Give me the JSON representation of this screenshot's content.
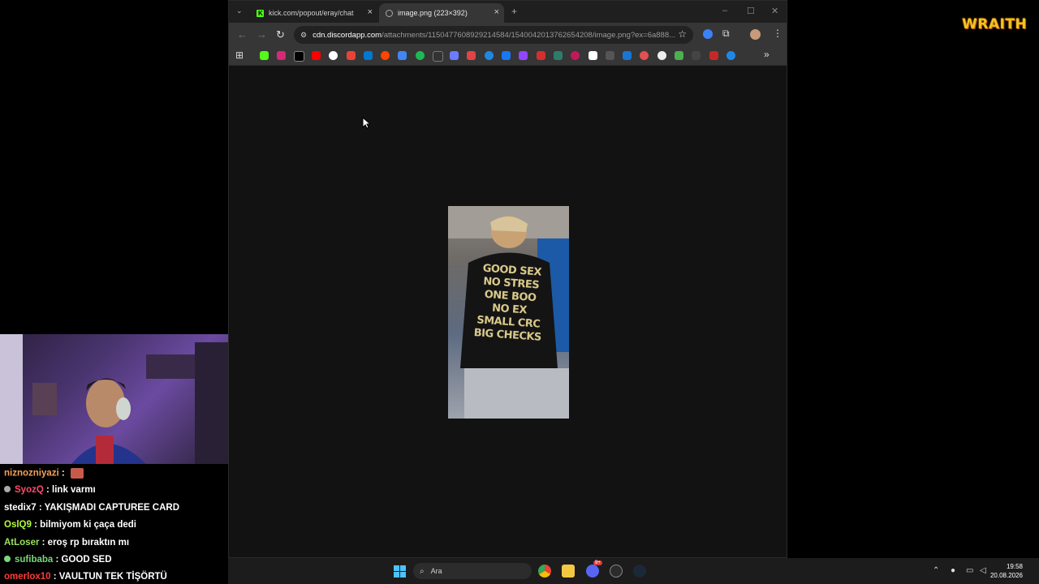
{
  "logo": {
    "text": "WRAITH"
  },
  "browser": {
    "tabs": [
      {
        "label": "kick.com/popout/eray/chat",
        "icon": "kick-icon",
        "active": false
      },
      {
        "label": "image.png (223×392)",
        "icon": "globe-icon",
        "active": true
      }
    ],
    "new_tab_glyph": "+",
    "close_glyph": "×",
    "omnibox": {
      "host": "cdn.discordapp.com",
      "path": "/attachments/1150477608929214584/1540042013762654208/image.png?ex=6a888..."
    },
    "bookmark_overflow": "»",
    "image": {
      "caption_lines": [
        "GOOD SEX",
        "NO STRES",
        "ONE BOO",
        "NO EX",
        "SMALL CRC",
        "BIG CHECKS"
      ]
    }
  },
  "chat": {
    "messages": [
      {
        "user": "niznozniyazi",
        "sep": " :",
        "text": "",
        "color": "#f4a259",
        "badge": false,
        "emote": true
      },
      {
        "user": "SyozQ",
        "sep": " :",
        "text": " link varmı",
        "color": "#ff4b6e",
        "badge": true,
        "emote": false
      },
      {
        "user": "stedix7",
        "sep": " :",
        "text": " YAKIŞMADI CAPTUREE CARD",
        "color": "#ffffff",
        "badge": false,
        "emote": false
      },
      {
        "user": "OslQ9",
        "sep": " :",
        "text": " bilmiyom ki çaça dedi",
        "color": "#b6ff3a",
        "badge": false,
        "emote": false
      },
      {
        "user": "AtLoser",
        "sep": " :",
        "text": " eroş rp bıraktın mı",
        "color": "#9be15d",
        "badge": false,
        "emote": false
      },
      {
        "user": "sufibaba",
        "sep": " :",
        "text": " GOOD SED",
        "color": "#7bd77b",
        "badge": true,
        "emote": false
      },
      {
        "user": "omerlox10",
        "sep": " :",
        "text": " VAULTUN TEK TİŞÖRTÜ",
        "color": "#ff3b3b",
        "badge": false,
        "emote": false
      }
    ]
  },
  "taskbar": {
    "search_placeholder": "Ara",
    "time": "19:58",
    "date": "20.08.2026",
    "discord_badge": "9+"
  }
}
